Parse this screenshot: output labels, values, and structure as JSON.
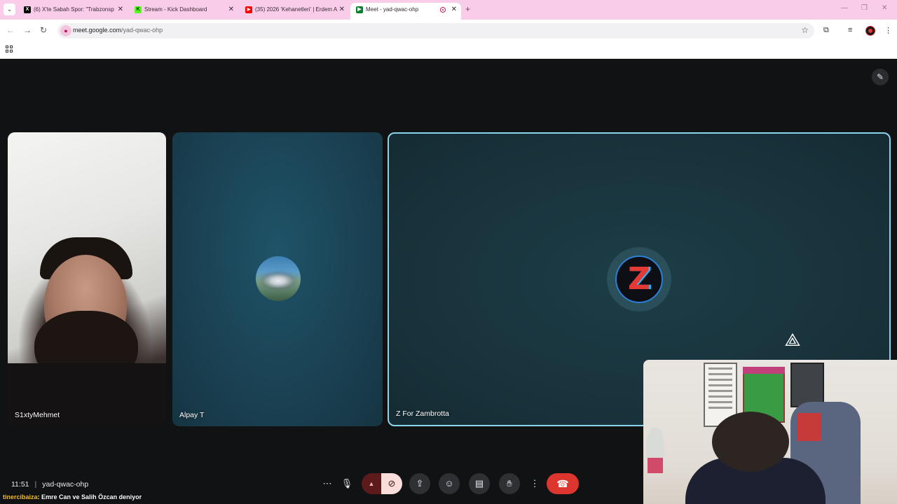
{
  "browser": {
    "tabs": [
      {
        "title": "(6) X'te Sabah Spor: \"Trabzonsp",
        "icon": "x-logo-icon",
        "color": "#000000"
      },
      {
        "title": "Stream - Kick Dashboard",
        "icon": "kick-logo-icon",
        "color": "#53fc18"
      },
      {
        "title": "(35) 2026 'Kehanetleri' | Erdem A",
        "icon": "youtube-logo-icon",
        "color": "#ff0000"
      },
      {
        "title": "Meet - yad-qwac-ohp",
        "icon": "google-meet-icon",
        "color": "#00832d",
        "active": true
      }
    ],
    "url_host": "meet.google.com",
    "url_path": "/yad-qwac-ohp",
    "tabbar_color": "#f9cdea"
  },
  "participants": [
    {
      "name": "S1xtyMehmet",
      "type": "video"
    },
    {
      "name": "Alpay T",
      "type": "avatar"
    },
    {
      "name": "Z For Zambrotta",
      "type": "avatar",
      "avatar_letter": "Z",
      "speaking": true
    }
  ],
  "meeting": {
    "time": "11:51",
    "separator": "|",
    "code": "yad-qwac-ohp"
  },
  "ticker": {
    "user": "tinercibaiza",
    "message": ": Emre Can ve Salih Özcan deniyor"
  },
  "controls": {
    "mic": "microphone-icon",
    "camera": "camera-off-icon",
    "end_call_color": "#dc362e"
  }
}
